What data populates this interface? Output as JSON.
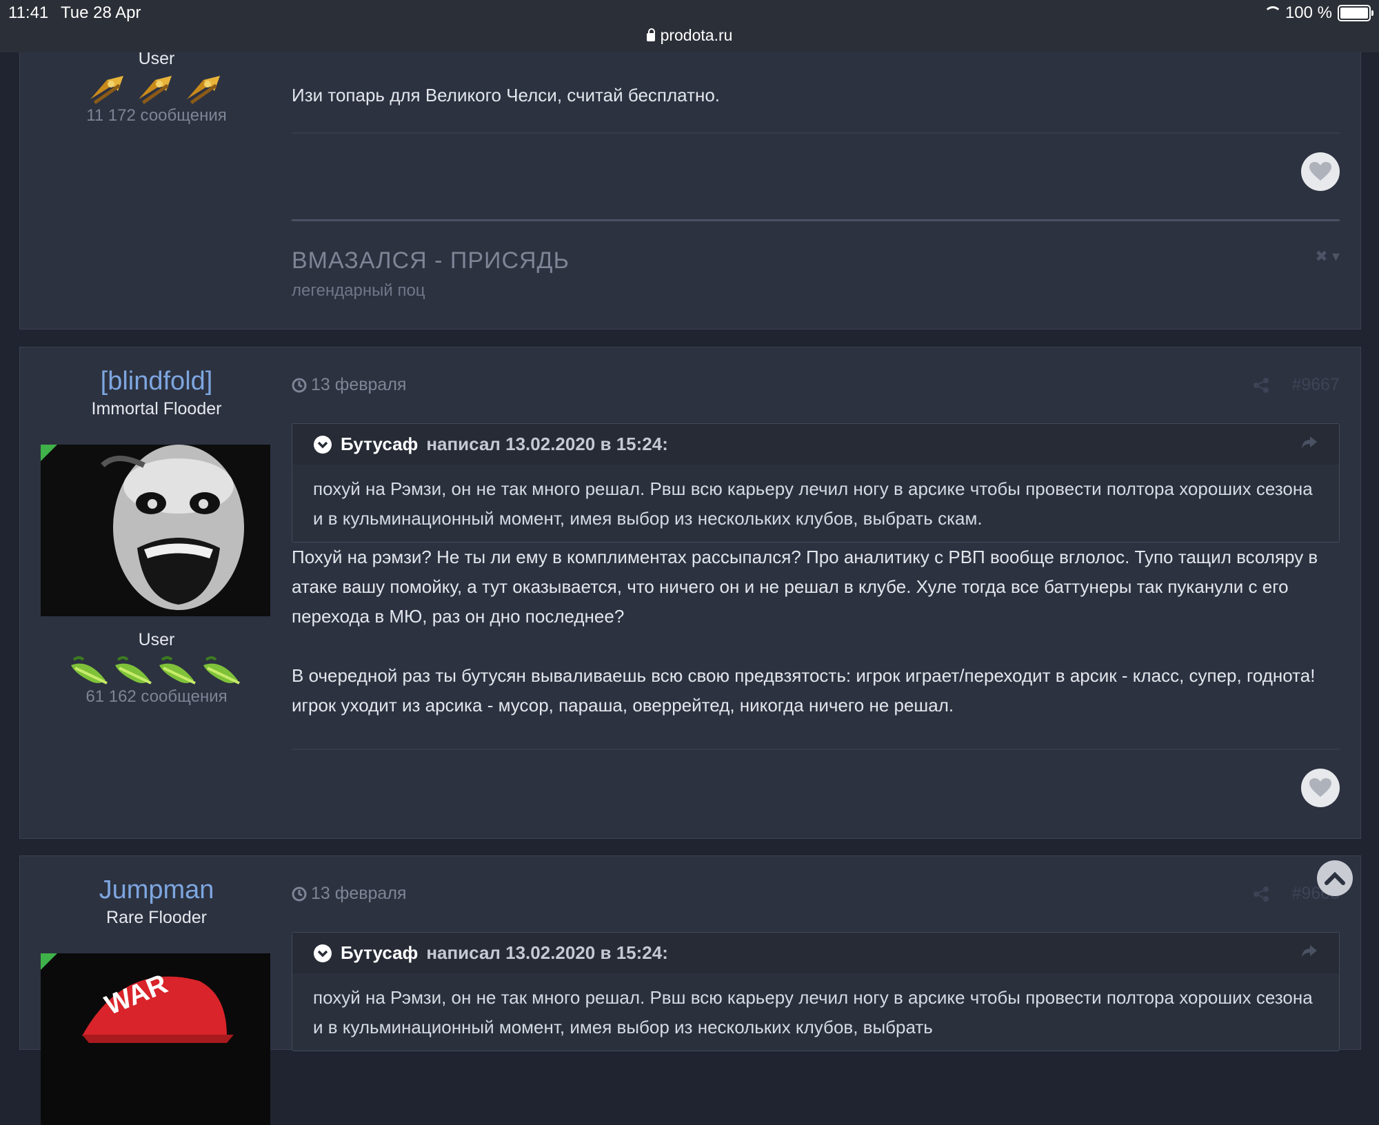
{
  "status_bar": {
    "time": "11:41",
    "date": "Tue 28 Apr",
    "url": "prodota.ru",
    "battery": "100 %"
  },
  "post_prev": {
    "author_role": "User",
    "author_posts": "11 172 сообщения",
    "text": "Изи топарь для Великого Челси, считай бесплатно.",
    "signature_title": "ВМАЗАЛСЯ - ПРИСЯДЬ",
    "signature_sub": "легендарный поц",
    "signature_ctrl": "✖ ▾"
  },
  "post_blindfold": {
    "author_name": "[blindfold]",
    "author_title": "Immortal Flooder",
    "author_role": "User",
    "author_posts": "61 162 сообщения",
    "date": "13 февраля",
    "post_number": "#9667",
    "quote": {
      "author": "Бутусаф",
      "wrote": "написал 13.02.2020 в 15:24:",
      "text": "похуй на Рэмзи, он не так много решал. Рвш всю карьеру лечил ногу в арсике чтобы провести полтора хороших сезона и в кульминационный момент, имея выбор из нескольких клубов, выбрать скам."
    },
    "paragraph1": "Похуй на рэмзи? Не ты ли ему в комплиментах рассыпался? Про аналитику с РВП вообще вглолос. Тупо тащил всоляру в атаке вашу помойку, а тут оказывается, что ничего он и не решал в клубе. Хуле тогда все баттунеры так пуканули с его перехода в МЮ, раз он дно последнее?",
    "paragraph2": "В очередной раз ты бутусян вываливаешь всю свою предвзятость: игрок играет/переходит в арсик - класс, супер, годнота! игрок уходит из арсика - мусор, параша, оверрейтед, никогда ничего не решал."
  },
  "post_jumpman": {
    "author_name": "Jumpman",
    "author_title": "Rare Flooder",
    "avatar_text": "WAR",
    "date": "13 февраля",
    "post_number": "#9668",
    "quote": {
      "author": "Бутусаф",
      "wrote": "написал 13.02.2020 в 15:24:",
      "text": "похуй на Рэмзи, он не так много решал. Рвш всю карьеру лечил ногу в арсике чтобы провести полтора хороших сезона и в кульминационный момент, имея выбор из нескольких клубов, выбрать"
    }
  },
  "colors": {
    "background": "#1f2430",
    "post_bg": "#2c3240",
    "author_link": "#7ea6e0",
    "muted": "#7d8596",
    "green_corner": "#3fb24a"
  }
}
